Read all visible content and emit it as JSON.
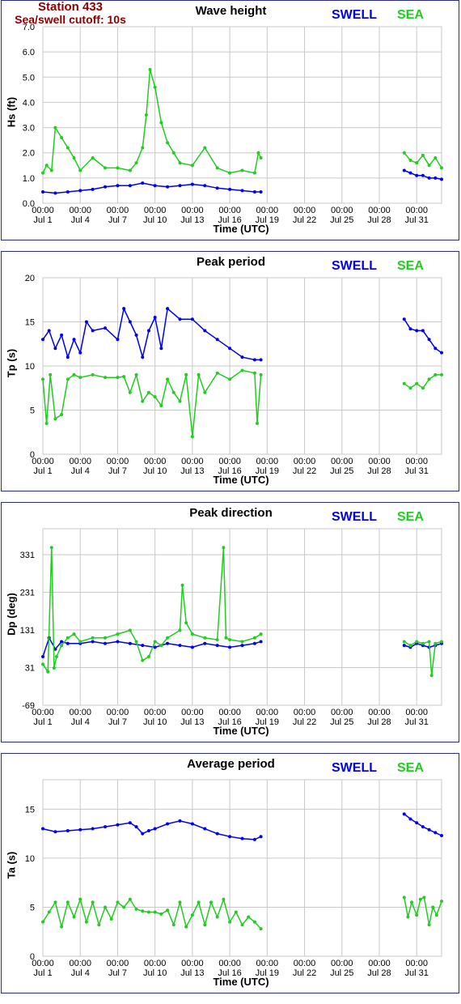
{
  "header": {
    "station": "Station 433",
    "cutoff": "Sea/swell cutoff: 10s"
  },
  "legend": {
    "swell": "SWELL",
    "sea": "SEA"
  },
  "colors": {
    "swell": "#0000ee",
    "sea": "#22cc22",
    "grid": "#c8c8c8",
    "frame": "#2b2b8a"
  },
  "chart_data": [
    {
      "type": "line",
      "title": "Wave height",
      "ylabel": "Hs (ft)",
      "xlabel": "Time (UTC)",
      "xlim": [
        0,
        32
      ],
      "ylim": [
        0,
        7
      ],
      "yticks": [
        0.0,
        1.0,
        2.0,
        3.0,
        4.0,
        5.0,
        6.0,
        7.0
      ],
      "ytick_labels": [
        "0.0",
        "1.0",
        "2.0",
        "3.0",
        "4.0",
        "5.0",
        "6.0",
        "7.0"
      ],
      "xticks": [
        0,
        3,
        6,
        9,
        12,
        15,
        18,
        21,
        24,
        27,
        30
      ],
      "xtick_labels": [
        "Jul 1",
        "Jul 4",
        "Jul 7",
        "Jul 10",
        "Jul 13",
        "Jul 16",
        "Jul 19",
        "Jul 22",
        "Jul 25",
        "Jul 28",
        "Jul 31"
      ],
      "xtick_time": "00:00",
      "series": [
        {
          "name": "SWELL",
          "x": [
            0,
            1,
            2,
            3,
            4,
            5,
            6,
            7,
            8,
            9,
            10,
            11,
            12,
            13,
            14,
            15,
            16,
            17,
            17.5,
            29,
            29.5,
            30,
            30.5,
            31,
            31.5,
            32
          ],
          "y": [
            0.45,
            0.4,
            0.45,
            0.5,
            0.55,
            0.65,
            0.7,
            0.7,
            0.8,
            0.7,
            0.65,
            0.7,
            0.75,
            0.7,
            0.6,
            0.55,
            0.5,
            0.45,
            0.45,
            1.3,
            1.2,
            1.1,
            1.1,
            1.0,
            1.0,
            0.95
          ]
        },
        {
          "name": "SEA",
          "x": [
            0,
            0.3,
            0.7,
            1,
            1.5,
            2,
            2.5,
            3,
            4,
            5,
            6,
            7,
            7.5,
            8,
            8.3,
            8.6,
            9,
            9.5,
            10,
            10.5,
            11,
            12,
            13,
            14,
            15,
            16,
            17,
            17.3,
            17.5,
            29,
            29.5,
            30,
            30.5,
            31,
            31.5,
            32
          ],
          "y": [
            1.2,
            1.5,
            1.3,
            3.0,
            2.6,
            2.2,
            1.8,
            1.3,
            1.8,
            1.4,
            1.4,
            1.3,
            1.6,
            2.2,
            3.5,
            5.3,
            4.6,
            3.2,
            2.4,
            2.0,
            1.6,
            1.5,
            2.2,
            1.4,
            1.2,
            1.3,
            1.2,
            2.0,
            1.8,
            2.0,
            1.7,
            1.6,
            1.9,
            1.5,
            1.8,
            1.4
          ]
        }
      ]
    },
    {
      "type": "line",
      "title": "Peak period",
      "ylabel": "Tp (s)",
      "xlabel": "Time (UTC)",
      "xlim": [
        0,
        32
      ],
      "ylim": [
        0,
        20
      ],
      "yticks": [
        0,
        5,
        10,
        15,
        20
      ],
      "ytick_labels": [
        "0",
        "5",
        "10",
        "15",
        "20"
      ],
      "xticks": [
        0,
        3,
        6,
        9,
        12,
        15,
        18,
        21,
        24,
        27,
        30
      ],
      "xtick_labels": [
        "Jul 1",
        "Jul 4",
        "Jul 7",
        "Jul 10",
        "Jul 13",
        "Jul 16",
        "Jul 19",
        "Jul 22",
        "Jul 25",
        "Jul 28",
        "Jul 31"
      ],
      "xtick_time": "00:00",
      "series": [
        {
          "name": "SWELL",
          "x": [
            0,
            0.5,
            1,
            1.5,
            2,
            2.5,
            3,
            3.5,
            4,
            5,
            6,
            6.5,
            7,
            7.5,
            8,
            8.5,
            9,
            9.5,
            10,
            11,
            12,
            13,
            14,
            15,
            16,
            17,
            17.5,
            29,
            29.5,
            30,
            30.5,
            31,
            31.5,
            32
          ],
          "y": [
            13,
            14,
            12,
            13.5,
            11,
            13,
            11.5,
            15,
            14,
            14.3,
            13,
            16.5,
            15,
            13.5,
            11,
            14,
            15.5,
            12,
            16.5,
            15.3,
            15.3,
            14,
            13,
            12,
            11,
            10.7,
            10.7,
            15.3,
            14.2,
            14,
            14,
            13,
            12,
            11.5
          ]
        },
        {
          "name": "SEA",
          "x": [
            0,
            0.3,
            0.6,
            1,
            1.5,
            2,
            2.5,
            3,
            4,
            5,
            6,
            6.5,
            7,
            7.5,
            8,
            8.5,
            9,
            9.5,
            10,
            10.5,
            11,
            11.5,
            12,
            12.5,
            13,
            14,
            15,
            16,
            17,
            17.2,
            17.5,
            29,
            29.5,
            30,
            30.5,
            31,
            31.5,
            32
          ],
          "y": [
            8.5,
            3.5,
            9,
            4,
            4.5,
            8.5,
            9,
            8.7,
            9,
            8.7,
            8.7,
            8.8,
            7,
            9,
            6,
            7,
            6.5,
            5.5,
            8.5,
            7,
            6,
            9,
            2,
            9,
            7,
            9.2,
            8.5,
            9.5,
            9.2,
            3.5,
            9,
            8,
            7.5,
            8,
            7.5,
            8.5,
            9,
            9
          ]
        }
      ]
    },
    {
      "type": "line",
      "title": "Peak direction",
      "ylabel": "Dp (deg)",
      "xlabel": "Time (UTC)",
      "xlim": [
        0,
        32
      ],
      "ylim": [
        -69,
        400
      ],
      "yticks": [
        -69,
        31,
        131,
        231,
        331
      ],
      "ytick_labels": [
        "-69",
        "31",
        "131",
        "231",
        "331"
      ],
      "xticks": [
        0,
        3,
        6,
        9,
        12,
        15,
        18,
        21,
        24,
        27,
        30
      ],
      "xtick_labels": [
        "Jul 1",
        "Jul 4",
        "Jul 7",
        "Jul 10",
        "Jul 13",
        "Jul 16",
        "Jul 19",
        "Jul 22",
        "Jul 25",
        "Jul 28",
        "Jul 31"
      ],
      "xtick_time": "00:00",
      "series": [
        {
          "name": "SWELL",
          "x": [
            0,
            0.5,
            1,
            1.5,
            2,
            3,
            4,
            5,
            6,
            7,
            8,
            9,
            10,
            11,
            12,
            13,
            14,
            15,
            16,
            17,
            17.5,
            29,
            29.5,
            30,
            30.5,
            31,
            31.5,
            32
          ],
          "y": [
            60,
            110,
            80,
            100,
            95,
            95,
            100,
            95,
            100,
            95,
            90,
            85,
            95,
            90,
            85,
            95,
            90,
            85,
            90,
            95,
            100,
            90,
            85,
            95,
            90,
            85,
            90,
            95
          ]
        },
        {
          "name": "SEA",
          "x": [
            0,
            0.4,
            0.7,
            0.9,
            1.1,
            1.5,
            2,
            2.5,
            3,
            4,
            5,
            6,
            7,
            7.5,
            8,
            8.5,
            9,
            9.5,
            10,
            11,
            11.2,
            11.5,
            12,
            13,
            14,
            14.5,
            14.7,
            15,
            16,
            17,
            17.5,
            29,
            29.5,
            30,
            30.5,
            31,
            31.2,
            31.5,
            32
          ],
          "y": [
            40,
            20,
            350,
            30,
            60,
            90,
            110,
            120,
            100,
            110,
            110,
            120,
            130,
            100,
            50,
            60,
            100,
            90,
            110,
            130,
            250,
            150,
            120,
            110,
            105,
            350,
            110,
            105,
            100,
            110,
            120,
            100,
            90,
            100,
            95,
            100,
            10,
            95,
            100
          ]
        }
      ]
    },
    {
      "type": "line",
      "title": "Average period",
      "ylabel": "Ta (s)",
      "xlabel": "Time (UTC)",
      "xlim": [
        0,
        32
      ],
      "ylim": [
        0,
        18
      ],
      "yticks": [
        0,
        5,
        10,
        15
      ],
      "ytick_labels": [
        "0",
        "5",
        "10",
        "15"
      ],
      "xticks": [
        0,
        3,
        6,
        9,
        12,
        15,
        18,
        21,
        24,
        27,
        30
      ],
      "xtick_labels": [
        "Jul 1",
        "Jul 4",
        "Jul 7",
        "Jul 10",
        "Jul 13",
        "Jul 16",
        "Jul 19",
        "Jul 22",
        "Jul 25",
        "Jul 28",
        "Jul 31"
      ],
      "xtick_time": "00:00",
      "series": [
        {
          "name": "SWELL",
          "x": [
            0,
            1,
            2,
            3,
            4,
            5,
            6,
            7,
            7.5,
            8,
            8.5,
            9,
            10,
            11,
            12,
            13,
            14,
            15,
            16,
            17,
            17.5,
            29,
            29.5,
            30,
            30.5,
            31,
            31.5,
            32
          ],
          "y": [
            13,
            12.7,
            12.8,
            12.9,
            13.0,
            13.2,
            13.4,
            13.6,
            13.2,
            12.5,
            12.8,
            13.0,
            13.5,
            13.8,
            13.5,
            13.0,
            12.5,
            12.2,
            12.0,
            11.9,
            12.2,
            14.5,
            14.0,
            13.6,
            13.2,
            12.9,
            12.6,
            12.3
          ]
        },
        {
          "name": "SEA",
          "x": [
            0,
            0.5,
            1,
            1.5,
            2,
            2.5,
            3,
            3.5,
            4,
            4.5,
            5,
            5.5,
            6,
            6.5,
            7,
            7.5,
            8,
            8.5,
            9,
            9.5,
            10,
            10.5,
            11,
            11.5,
            12,
            12.5,
            13,
            13.5,
            14,
            14.5,
            15,
            15.5,
            16,
            16.5,
            17,
            17.5,
            29,
            29.3,
            29.6,
            30,
            30.3,
            30.6,
            31,
            31.3,
            31.6,
            32
          ],
          "y": [
            3.5,
            4.5,
            5.5,
            3.0,
            5.5,
            4.0,
            5.8,
            3.5,
            5.5,
            3.2,
            5.0,
            3.8,
            5.5,
            5.0,
            5.8,
            4.8,
            4.6,
            4.5,
            4.5,
            4.3,
            4.7,
            3.2,
            5.5,
            3.0,
            4.2,
            5.5,
            3.2,
            5.5,
            4.0,
            5.8,
            3.5,
            4.5,
            3.2,
            4.0,
            3.5,
            2.8,
            6.0,
            4.0,
            5.5,
            4.2,
            5.8,
            6.0,
            3.2,
            5.0,
            4.2,
            5.6
          ]
        }
      ]
    }
  ]
}
